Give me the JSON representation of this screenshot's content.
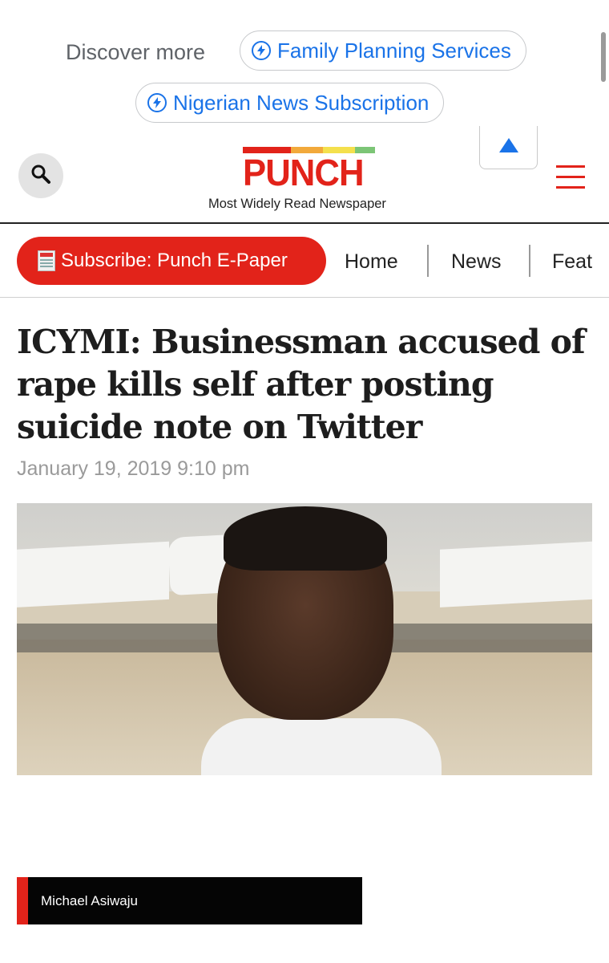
{
  "discover": {
    "label": "Discover more",
    "chips": [
      "Family Planning Services",
      "Nigerian News Subscription"
    ]
  },
  "header": {
    "logo_text": "PUNCH",
    "tagline": "Most Widely Read Newspaper",
    "colors": {
      "brand": "#e2231a",
      "link": "#1a73e8"
    },
    "logo_bar_colors": [
      "#e2231a",
      "#f2a93b",
      "#f4e04d",
      "#7cc576"
    ]
  },
  "nav": {
    "subscribe_label": "Subscribe: Punch E-Paper",
    "items": [
      "Home",
      "News",
      "Featured"
    ]
  },
  "article": {
    "headline": "ICYMI: Businessman accused of rape kills self after posting suicide note on Twitter",
    "date": "January 19, 2019 9:10 pm",
    "author": "Michael Asiwaju"
  }
}
